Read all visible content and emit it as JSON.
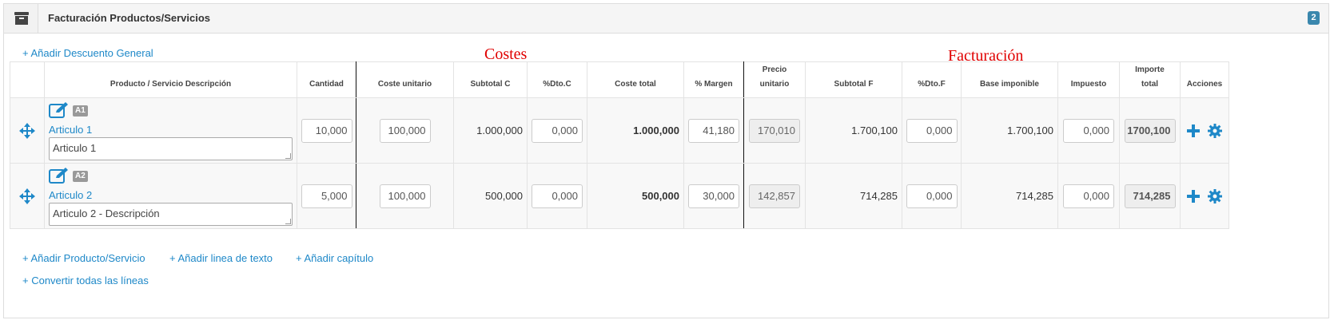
{
  "panel": {
    "title": "Facturación Productos/Servicios",
    "badge": "2",
    "header_icon": "archive-icon"
  },
  "top_links": {
    "add_general_discount": "+ Añadir Descuento General"
  },
  "section_labels": {
    "costs": "Costes",
    "billing": "Facturación"
  },
  "table": {
    "headers": {
      "product": "Producto / Servicio Descripción",
      "quantity": "Cantidad",
      "unit_cost": "Coste unitario",
      "subtotal_c": "Subtotal C",
      "dto_c": "%Dto.C",
      "total_cost": "Coste total",
      "margin": "% Margen",
      "unit_price_line1": "Precio",
      "unit_price_line2": "unitario",
      "subtotal_f": "Subtotal F",
      "dto_f": "%Dto.F",
      "tax_base": "Base imponible",
      "tax": "Impuesto",
      "total_amount_line1": "Importe",
      "total_amount_line2": "total",
      "actions": "Acciones"
    },
    "rows": [
      {
        "tag": "A1",
        "name": "Articulo 1",
        "description": "Articulo 1",
        "quantity": "10,000",
        "unit_cost": "100,000",
        "subtotal_c": "1.000,000",
        "dto_c": "0,000",
        "total_cost": "1.000,000",
        "margin": "41,180",
        "unit_price": "170,010",
        "subtotal_f": "1.700,100",
        "dto_f": "0,000",
        "tax_base": "1.700,100",
        "tax": "0,000",
        "total_amount": "1700,100"
      },
      {
        "tag": "A2",
        "name": "Articulo 2",
        "description": "Articulo 2 - Descripción",
        "quantity": "5,000",
        "unit_cost": "100,000",
        "subtotal_c": "500,000",
        "dto_c": "0,000",
        "total_cost": "500,000",
        "margin": "30,000",
        "unit_price": "142,857",
        "subtotal_f": "714,285",
        "dto_f": "0,000",
        "tax_base": "714,285",
        "tax": "0,000",
        "total_amount": "714,285"
      }
    ]
  },
  "bottom_links": {
    "add_product": "+ Añadir Producto/Servicio",
    "add_text_line": "+ Añadir linea de texto",
    "add_chapter": "+ Añadir capítulo",
    "convert_all": "+ Convertir todas las líneas"
  },
  "colors": {
    "link": "#1e88c8",
    "badge": "#3a87ad",
    "section_label": "#e00000",
    "icon_blue": "#1e88c8"
  }
}
